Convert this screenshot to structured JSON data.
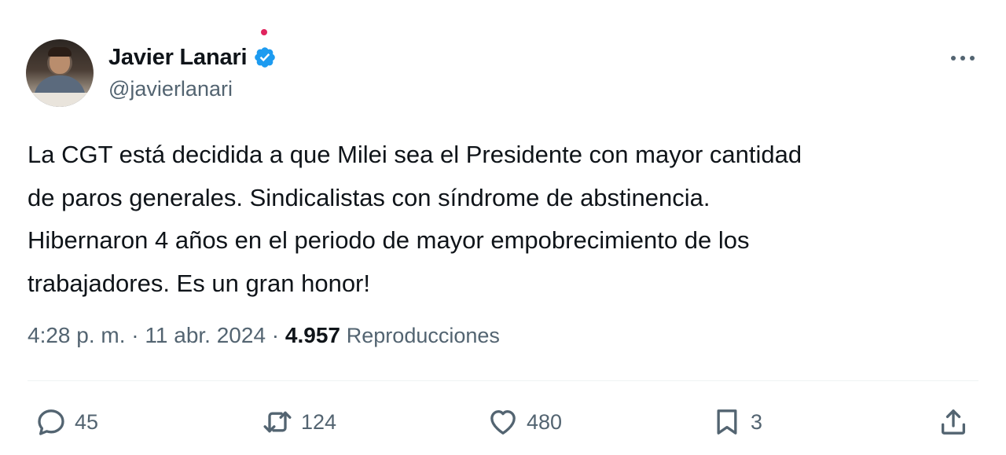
{
  "author": {
    "display_name": "Javier Lanari",
    "handle": "@javierlanari",
    "verified": true
  },
  "tweet": {
    "text": "La CGT está decidida a que Milei sea el Presidente con mayor cantidad\nde paros generales. Sindicalistas con síndrome de abstinencia.\nHibernaron 4 años en el periodo de mayor empobrecimiento de los\ntrabajadores. Es un gran honor!",
    "time": "4:28 p. m.",
    "separator": " · ",
    "date": "11 abr. 2024",
    "views": "4.957",
    "views_label": "Reproducciones"
  },
  "actions": {
    "replies": "45",
    "retweets": "124",
    "likes": "480",
    "bookmarks": "3"
  },
  "icons": {
    "more": "more-horizontal-icon",
    "reply": "reply-icon",
    "retweet": "retweet-icon",
    "like": "heart-icon",
    "bookmark": "bookmark-icon",
    "share": "share-icon",
    "verified": "verified-badge-icon"
  },
  "colors": {
    "text": "#0f1419",
    "secondary": "#536471",
    "verified_blue": "#1d9bf0",
    "divider": "#eff3f4"
  }
}
